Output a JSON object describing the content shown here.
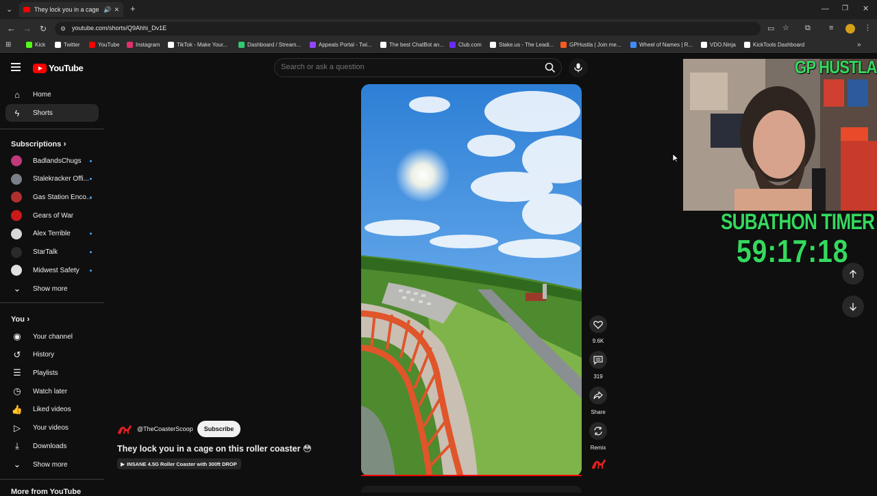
{
  "browser": {
    "tab_title": "They lock you in a cage on th",
    "url": "youtube.com/shorts/Q9Ahhi_Dv1E",
    "bookmarks": [
      {
        "label": "Kick",
        "color": "#53fc18"
      },
      {
        "label": "Twitter",
        "color": "#ffffff"
      },
      {
        "label": "YouTube",
        "color": "#ff0000"
      },
      {
        "label": "Instagram",
        "color": "#e1306c"
      },
      {
        "label": "TikTok - Make Your...",
        "color": "#ffffff"
      },
      {
        "label": "Dashboard / Stream...",
        "color": "#2ecc71"
      },
      {
        "label": "Appeals Portal - Twi...",
        "color": "#9146ff"
      },
      {
        "label": "The best ChatBot an...",
        "color": "#ffffff"
      },
      {
        "label": "Club.com",
        "color": "#6a2cff"
      },
      {
        "label": "Stake.us - The Leadi...",
        "color": "#ffffff"
      },
      {
        "label": "GPHustla | Join me...",
        "color": "#ff5a1f"
      },
      {
        "label": "Wheel of Names | R...",
        "color": "#3f8cff"
      },
      {
        "label": "VDO.Ninja",
        "color": "#ffffff"
      },
      {
        "label": "KickTools Dashboard",
        "color": "#ffffff"
      }
    ]
  },
  "youtube": {
    "logo_text": "YouTube",
    "search_placeholder": "Search or ask a question",
    "sidebar": {
      "main": [
        {
          "label": "Home",
          "icon": "home-icon"
        },
        {
          "label": "Shorts",
          "icon": "shorts-icon",
          "active": true
        }
      ],
      "subscriptions_heading": "Subscriptions",
      "subscriptions": [
        {
          "label": "BadlandsChugs",
          "color": "#c0397a",
          "live": true
        },
        {
          "label": "Stalekracker Offi...",
          "color": "#7a8088",
          "live": true
        },
        {
          "label": "Gas Station Enco...",
          "color": "#b03030",
          "live": true
        },
        {
          "label": "Gears of War",
          "color": "#cc1a1a",
          "live": false
        },
        {
          "label": "Alex Terrible",
          "color": "#d8d8d8",
          "live": true
        },
        {
          "label": "StarTalk",
          "color": "#2a2a2a",
          "live": true
        },
        {
          "label": "Midwest Safety",
          "color": "#e0e0e0",
          "live": true
        }
      ],
      "show_more_1": "Show more",
      "you_heading": "You",
      "you_items": [
        {
          "label": "Your channel",
          "icon": "channel-icon"
        },
        {
          "label": "History",
          "icon": "history-icon"
        },
        {
          "label": "Playlists",
          "icon": "playlists-icon"
        },
        {
          "label": "Watch later",
          "icon": "watch-later-icon"
        },
        {
          "label": "Liked videos",
          "icon": "liked-icon"
        },
        {
          "label": "Your videos",
          "icon": "your-videos-icon"
        },
        {
          "label": "Downloads",
          "icon": "downloads-icon"
        }
      ],
      "show_more_2": "Show more",
      "more_from_heading": "More from YouTube"
    },
    "short": {
      "channel": "@TheCoasterScoop",
      "subscribe_label": "Subscribe",
      "title": "They lock you in a cage on this roller coaster 😳",
      "related_chip": "INSANE 4.5G Roller Coaster with 300ft DROP",
      "likes": "9.6K",
      "comments": "319",
      "share_label": "Share",
      "remix_label": "Remix"
    }
  },
  "overlay": {
    "brand": "GP HUSTLA",
    "timer_label": "SUBATHON TIMER",
    "timer_value": "59:17:18"
  }
}
